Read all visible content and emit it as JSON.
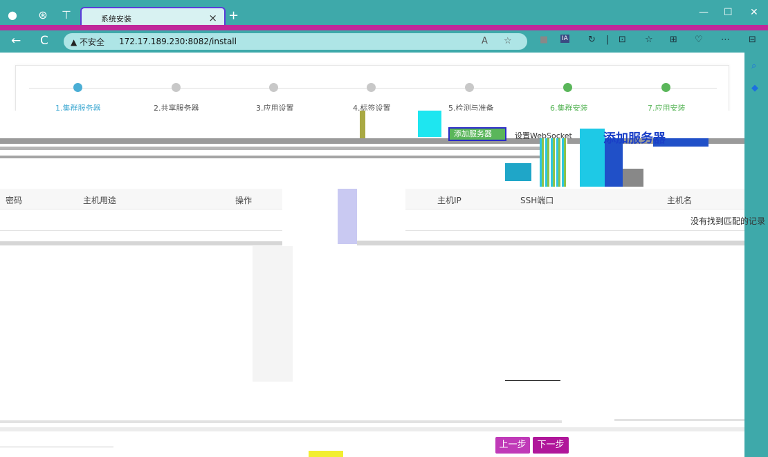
{
  "browser": {
    "tab_title": "系统安装",
    "tab_close": "×",
    "new_tab": "+",
    "window_controls": [
      "—",
      "☐",
      "✕"
    ],
    "nav": {
      "back": "←",
      "refresh": "C"
    },
    "security_warning": "▲ 不安全",
    "url": "172.17.189.230:8082/install",
    "url_icons": [
      "A",
      "☆"
    ],
    "toolbar_icons": [
      "IA",
      "↻",
      "|",
      "⊡",
      "☆",
      "⊞",
      "♡",
      "⋯"
    ],
    "sidebar_icons": [
      "search-icon",
      "tag-icon"
    ]
  },
  "wizard": {
    "steps": [
      {
        "label": "1.集群服务器",
        "status": "active"
      },
      {
        "label": "2.共享服务器",
        "status": "pending"
      },
      {
        "label": "3.应用设置",
        "status": "pending"
      },
      {
        "label": "4.标签设置",
        "status": "pending"
      },
      {
        "label": "5.检测与准备",
        "status": "pending"
      },
      {
        "label": "6.集群安装",
        "status": "done"
      },
      {
        "label": "7.应用安装",
        "status": "done"
      }
    ],
    "colors": {
      "active": "#4aaed5",
      "pending": "#c8c8c8",
      "done": "#5ab65a"
    }
  },
  "toolbar": {
    "add_server": "添加服务器",
    "websocket": "设置WebSocket",
    "heading": "添加服务器"
  },
  "left_table": {
    "columns": [
      "密码",
      "主机用途",
      "操作"
    ],
    "add_symbol": "+"
  },
  "right_table": {
    "columns": [
      "主机IP",
      "SSH端口",
      "主机名"
    ],
    "empty_message": "没有找到匹配的记录"
  },
  "footer": {
    "prev": "上一步",
    "next": "下一步"
  }
}
